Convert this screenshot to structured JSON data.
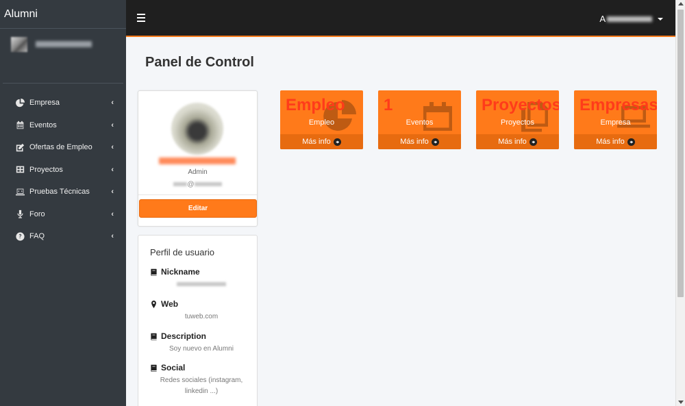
{
  "sidebar": {
    "brand": "Alumni",
    "items": [
      {
        "label": "Empresa"
      },
      {
        "label": "Eventos"
      },
      {
        "label": "Ofertas de Empleo"
      },
      {
        "label": "Proyectos"
      },
      {
        "label": "Pruebas Técnicas"
      },
      {
        "label": "Foro"
      },
      {
        "label": "FAQ"
      }
    ],
    "chevron": "‹"
  },
  "topbar": {
    "user_initial": "A"
  },
  "main": {
    "title": "Panel de Control"
  },
  "profile": {
    "role": "Admin",
    "email_at": "@",
    "edit_label": "Editar"
  },
  "info": {
    "title": "Perfil de usuario",
    "fields": [
      {
        "label": "Nickname",
        "value": ""
      },
      {
        "label": "Web",
        "value": "tuweb.com"
      },
      {
        "label": "Description",
        "value": "Soy nuevo en Alumni"
      },
      {
        "label": "Social",
        "value": "Redes sociales (instagram, linkedin ...)"
      }
    ]
  },
  "stats": [
    {
      "big": "Empleo",
      "label": "Empleo",
      "more": "Más info",
      "icon": "pie-chart-icon"
    },
    {
      "big": "1",
      "label": "Eventos",
      "more": "Más info",
      "icon": "calendar-icon"
    },
    {
      "big": "Proyectos",
      "label": "Proyectos",
      "more": "Más info",
      "icon": "copy-icon"
    },
    {
      "big": "Empresas",
      "label": "Empresa",
      "more": "Más info",
      "icon": "laptop-icon"
    }
  ],
  "colors": {
    "accent": "#ff7a1a",
    "sidebar_bg": "#343a40",
    "topbar_bg": "#1f1f1f",
    "stat_big_text": "#ff3c1a"
  }
}
